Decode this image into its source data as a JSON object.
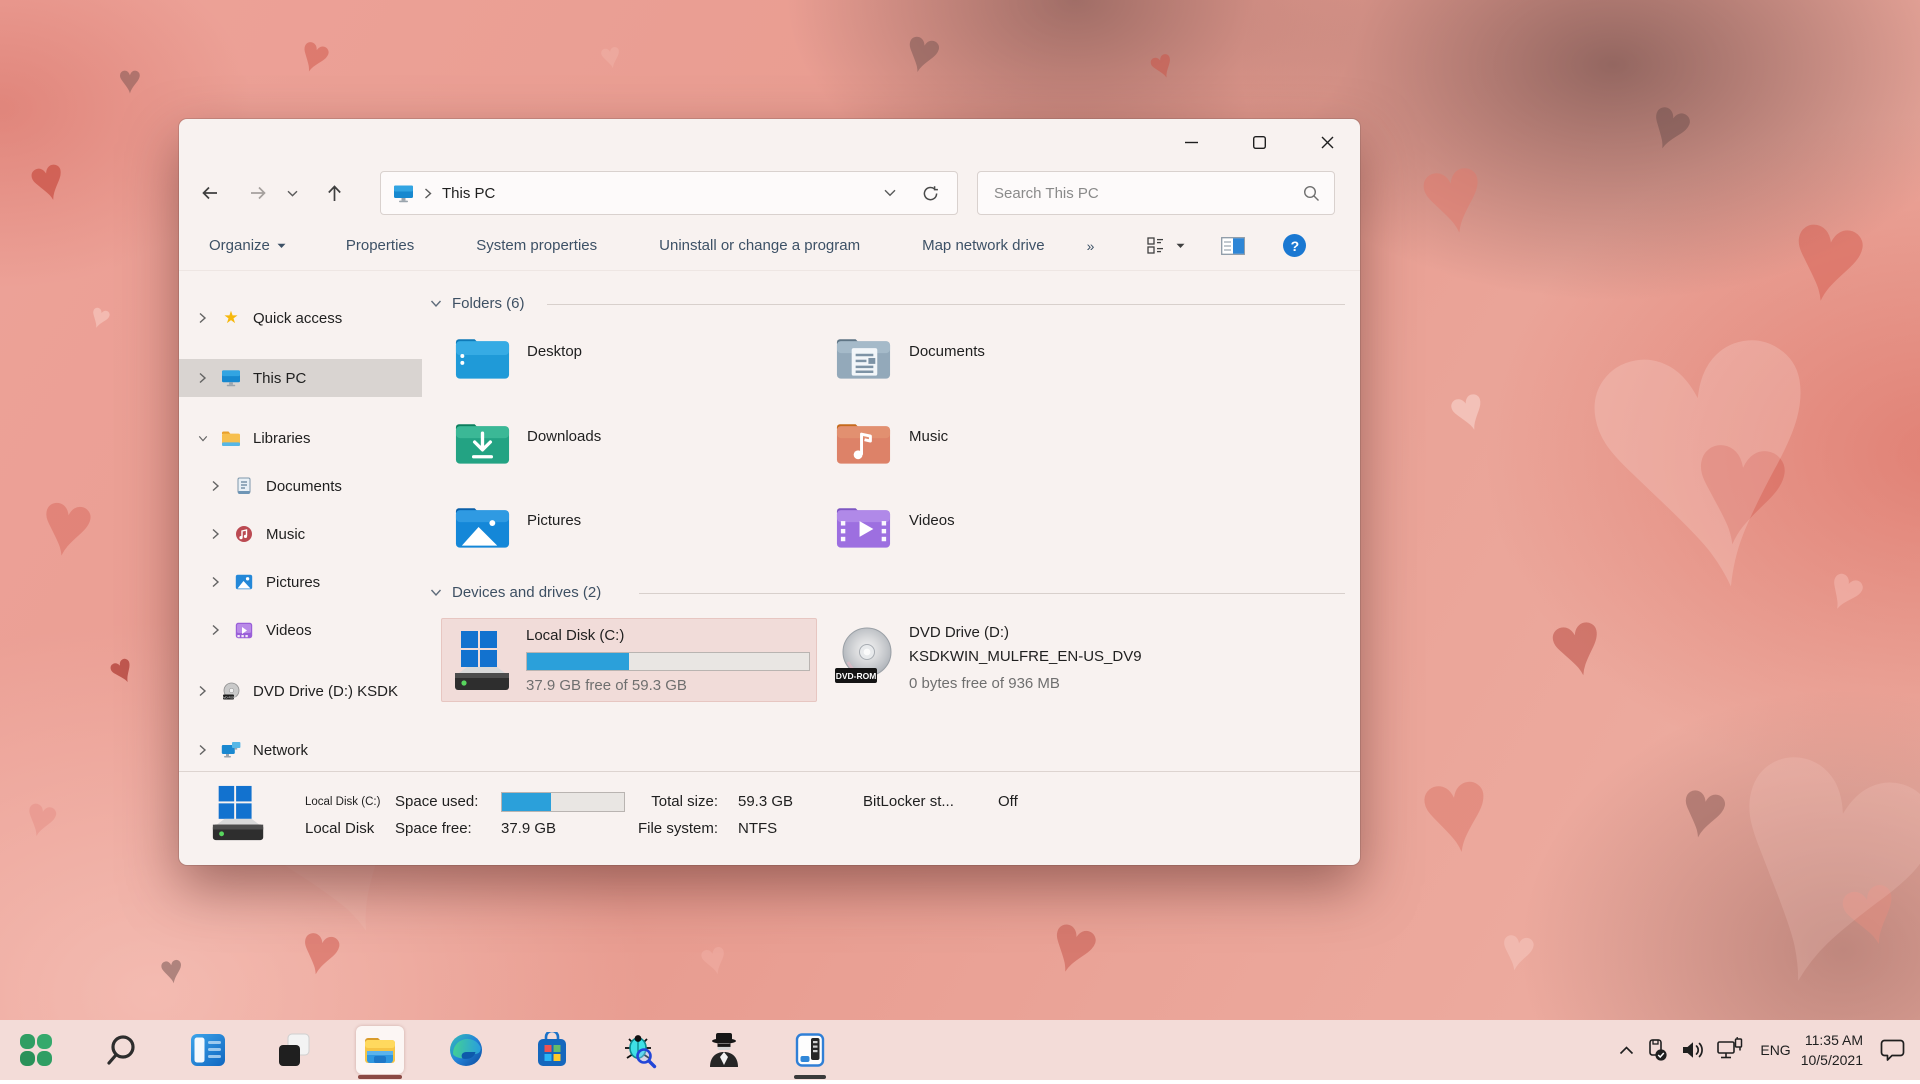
{
  "window": {
    "app": "File Explorer",
    "controls": {
      "minimize": "minimize",
      "maximize": "maximize",
      "close": "close"
    }
  },
  "navbar": {
    "breadcrumb": {
      "icon": "this-pc-monitor",
      "location": "This PC"
    },
    "search": {
      "placeholder": "Search This PC"
    }
  },
  "toolbar": {
    "items": [
      {
        "label": "Organize",
        "has_dropdown": true
      },
      {
        "label": "Properties"
      },
      {
        "label": "System properties"
      },
      {
        "label": "Uninstall or change a program"
      },
      {
        "label": "Map network drive"
      }
    ],
    "overflow": "»",
    "icons": [
      "view-options-icon",
      "view-dropdown-caret",
      "preview-pane-icon",
      "help-icon"
    ],
    "help_glyph": "?"
  },
  "sidebar": {
    "items": [
      {
        "label": "Quick access",
        "icon": "star",
        "level": 0,
        "expanded": false
      },
      {
        "label": "This PC",
        "icon": "monitor",
        "level": 0,
        "expanded": false,
        "selected": true
      },
      {
        "label": "Libraries",
        "icon": "folder",
        "level": 0,
        "expanded": true
      },
      {
        "label": "Documents",
        "icon": "document",
        "level": 1
      },
      {
        "label": "Music",
        "icon": "music",
        "level": 1
      },
      {
        "label": "Pictures",
        "icon": "picture",
        "level": 1
      },
      {
        "label": "Videos",
        "icon": "video",
        "level": 1
      },
      {
        "label": "DVD Drive (D:) KSDK",
        "icon": "disc",
        "level": 0
      },
      {
        "label": "Network",
        "icon": "network",
        "level": 0
      }
    ]
  },
  "main": {
    "sections": {
      "folders": {
        "title": "Folders (6)"
      },
      "drives": {
        "title": "Devices and drives (2)"
      }
    },
    "folders": [
      {
        "name": "Desktop",
        "icon": "desktop-folder"
      },
      {
        "name": "Documents",
        "icon": "documents-folder"
      },
      {
        "name": "Downloads",
        "icon": "downloads-folder"
      },
      {
        "name": "Music",
        "icon": "music-folder"
      },
      {
        "name": "Pictures",
        "icon": "pictures-folder"
      },
      {
        "name": "Videos",
        "icon": "videos-folder"
      }
    ],
    "drives": [
      {
        "name": "Local Disk (C:)",
        "free_text": "37.9 GB free of 59.3 GB",
        "used_percent": 36,
        "selected": true
      },
      {
        "name": "DVD Drive (D:)",
        "volume": "KSDKWIN_MULFRE_EN-US_DV9",
        "free_text": "0 bytes free of 936 MB",
        "badge": "DVD-ROM"
      }
    ]
  },
  "statusbar": {
    "drive_small": "Local Disk (C:)",
    "drive_name": "Local Disk",
    "space_used_label": "Space used:",
    "used_percent": 40,
    "space_free_label": "Space free:",
    "space_free_value": "37.9 GB",
    "total_size_label": "Total size:",
    "total_size_value": "59.3 GB",
    "file_system_label": "File system:",
    "file_system_value": "NTFS",
    "bitlocker_label": "BitLocker st...",
    "bitlocker_value": "Off"
  },
  "taskbar": {
    "icons": [
      "start-clover",
      "search",
      "task-view",
      "virtual-desktops",
      "file-explorer",
      "edge",
      "microsoft-store",
      "debug-tool",
      "spy-tool",
      "device-manager"
    ],
    "tray": {
      "hidden_icons": "chevron-up",
      "usb": "usb-eject-icon",
      "volume": "speaker-icon",
      "network": "wired-network-icon",
      "language": "ENG",
      "time": "11:35 AM",
      "date": "10/5/2021",
      "notifications": "chat-bubble-icon"
    }
  }
}
